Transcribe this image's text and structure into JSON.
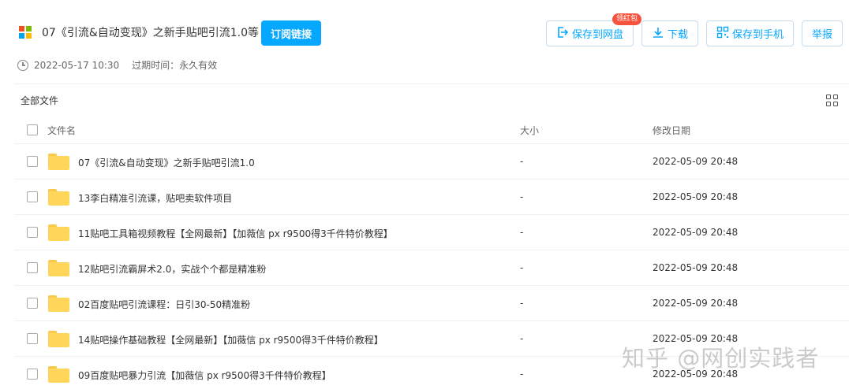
{
  "header": {
    "title": "07《引流&自动变现》之新手贴吧引流1.0等",
    "subscribe_label": "订阅链接",
    "date": "2022-05-17 10:30",
    "expire_text": "过期时间：永久有效",
    "brand_colors": [
      "#f25022",
      "#7fba00",
      "#00a4ef",
      "#ffb900"
    ]
  },
  "actions": {
    "save_to_netdisk": "保存到网盘",
    "red_packet_badge": "领红包",
    "download": "下载",
    "save_to_phone": "保存到手机",
    "report": "举报"
  },
  "toolbar": {
    "all_files": "全部文件"
  },
  "table": {
    "columns": [
      "文件名",
      "大小",
      "修改日期"
    ],
    "rows": [
      {
        "name": "07《引流&自动变现》之新手贴吧引流1.0",
        "size": "-",
        "date": "2022-05-09 20:48"
      },
      {
        "name": "13李白精准引流课，贴吧卖软件项目",
        "size": "-",
        "date": "2022-05-09 20:48"
      },
      {
        "name": "11贴吧工具箱视频教程【全网最新】【加薇信 px r9500得3千件特价教程】",
        "size": "-",
        "date": "2022-05-09 20:48"
      },
      {
        "name": "12贴吧引流霸屏术2.0，实战个个都是精准粉",
        "size": "-",
        "date": "2022-05-09 20:48"
      },
      {
        "name": "02百度贴吧引流课程：日引30-50精准粉",
        "size": "-",
        "date": "2022-05-09 20:48"
      },
      {
        "name": "14贴吧操作基础教程【全网最新】【加薇信 px r9500得3千件特价教程】",
        "size": "-",
        "date": "2022-05-09 20:48"
      },
      {
        "name": "09百度贴吧暴力引流【加薇信 px r9500得3千件特价教程】",
        "size": "-",
        "date": "2022-05-09 20:48"
      }
    ]
  },
  "watermark": "知乎 @网创实践者",
  "colors": {
    "accent": "#06a7ff",
    "badge": "#f5533d",
    "folder": "#ffd659"
  }
}
